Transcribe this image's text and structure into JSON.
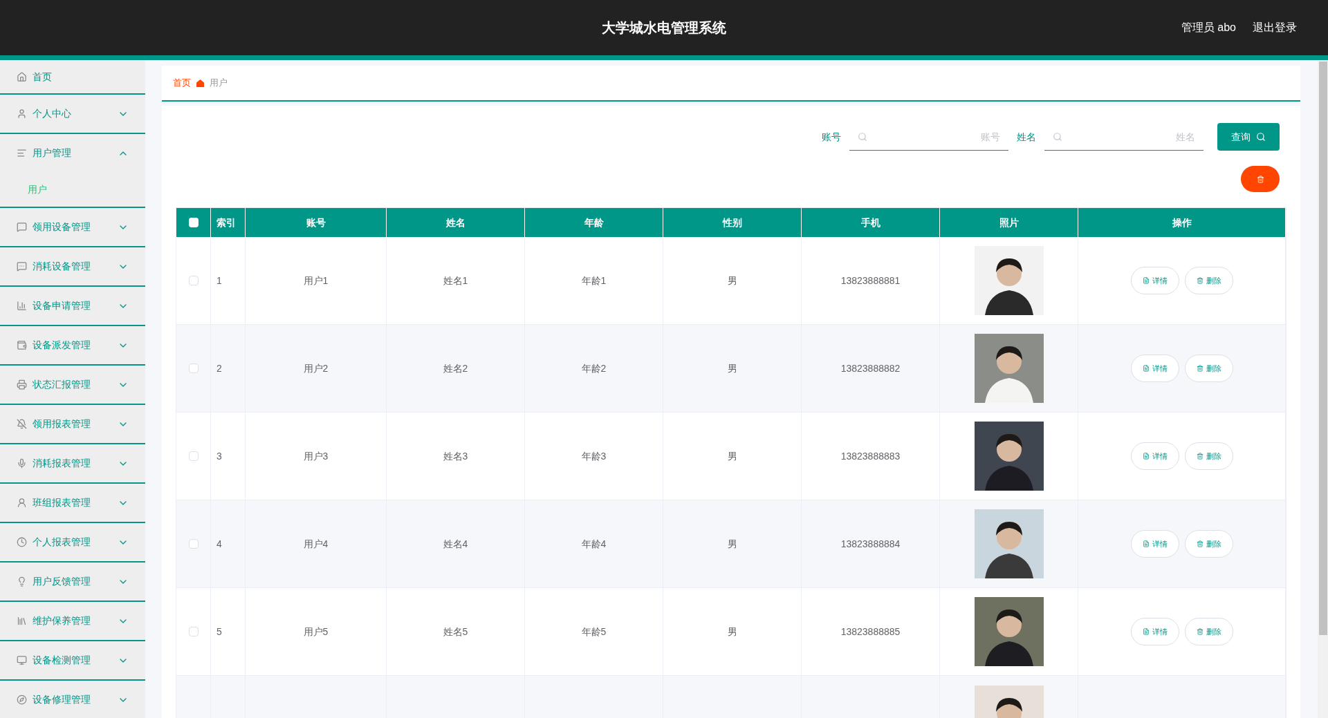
{
  "header": {
    "title": "大学城水电管理系统",
    "user": "管理员 abo",
    "logout": "退出登录"
  },
  "sidebar": {
    "items": [
      {
        "kind": "link",
        "label": "首页"
      },
      {
        "kind": "menu",
        "label": "个人中心",
        "expanded": false
      },
      {
        "kind": "menu",
        "label": "用户管理",
        "expanded": true,
        "children": [
          {
            "label": "用户",
            "selected": true
          }
        ]
      },
      {
        "kind": "menu",
        "label": "领用设备管理",
        "expanded": false
      },
      {
        "kind": "menu",
        "label": "消耗设备管理",
        "expanded": false
      },
      {
        "kind": "menu",
        "label": "设备申请管理",
        "expanded": false
      },
      {
        "kind": "menu",
        "label": "设备派发管理",
        "expanded": false
      },
      {
        "kind": "menu",
        "label": "状态汇报管理",
        "expanded": false
      },
      {
        "kind": "menu",
        "label": "领用报表管理",
        "expanded": false
      },
      {
        "kind": "menu",
        "label": "消耗报表管理",
        "expanded": false
      },
      {
        "kind": "menu",
        "label": "班组报表管理",
        "expanded": false
      },
      {
        "kind": "menu",
        "label": "个人报表管理",
        "expanded": false
      },
      {
        "kind": "menu",
        "label": "用户反馈管理",
        "expanded": false
      },
      {
        "kind": "menu",
        "label": "维护保养管理",
        "expanded": false
      },
      {
        "kind": "menu",
        "label": "设备检测管理",
        "expanded": false
      },
      {
        "kind": "menu",
        "label": "设备修理管理",
        "expanded": false
      }
    ]
  },
  "breadcrumb": [
    {
      "label": "首页",
      "selected": false
    },
    {
      "label": "用户",
      "selected": true
    }
  ],
  "search": {
    "fields": [
      {
        "label": "账号",
        "placeholder": "账号"
      },
      {
        "label": "姓名",
        "placeholder": "姓名"
      }
    ],
    "button": "查询"
  },
  "table": {
    "columns": [
      "索引",
      "账号",
      "姓名",
      "年龄",
      "性别",
      "手机",
      "照片",
      "操作"
    ],
    "all_checked": false,
    "rows": [
      {
        "checked": false,
        "index": "1",
        "account": "用户1",
        "name": "姓名1",
        "age": "年龄1",
        "gender": "男",
        "phone": "13823888881",
        "actions": [
          "详情",
          "删除"
        ]
      },
      {
        "checked": false,
        "index": "2",
        "account": "用户2",
        "name": "姓名2",
        "age": "年龄2",
        "gender": "男",
        "phone": "13823888882",
        "actions": [
          "详情",
          "删除"
        ]
      },
      {
        "checked": false,
        "index": "3",
        "account": "用户3",
        "name": "姓名3",
        "age": "年龄3",
        "gender": "男",
        "phone": "13823888883",
        "actions": [
          "详情",
          "删除"
        ]
      },
      {
        "checked": false,
        "index": "4",
        "account": "用户4",
        "name": "姓名4",
        "age": "年龄4",
        "gender": "男",
        "phone": "13823888884",
        "actions": [
          "详情",
          "删除"
        ]
      },
      {
        "checked": false,
        "index": "5",
        "account": "用户5",
        "name": "姓名5",
        "age": "年龄5",
        "gender": "男",
        "phone": "13823888885",
        "actions": [
          "详情",
          "删除"
        ]
      }
    ]
  }
}
